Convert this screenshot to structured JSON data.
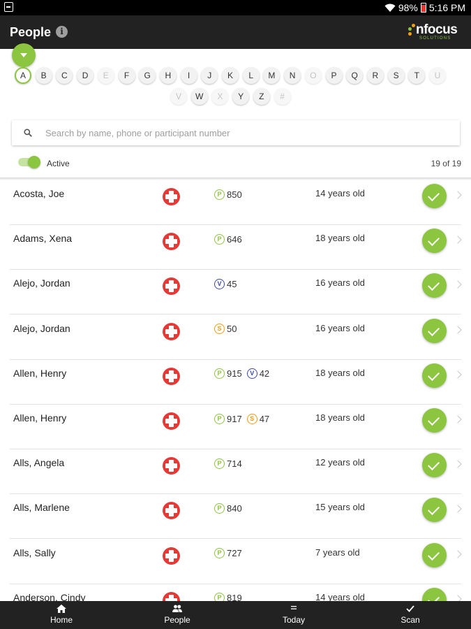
{
  "status_bar": {
    "battery": "98%",
    "time": "5:16 PM"
  },
  "app_bar": {
    "title": "People",
    "info_symbol": "i",
    "logo_text": "nfocus",
    "logo_sub": "SOLUTIONS"
  },
  "colors": {
    "accent": "#8cc540",
    "appbar": "#222222",
    "medical": "#e53935",
    "badge_P": "#8cc540",
    "badge_V": "#3949ab",
    "badge_S": "#f39c12"
  },
  "alphabet": {
    "selected": "A",
    "rows": [
      [
        {
          "label": "A",
          "enabled": true
        },
        {
          "label": "B",
          "enabled": true
        },
        {
          "label": "C",
          "enabled": true
        },
        {
          "label": "D",
          "enabled": true
        },
        {
          "label": "E",
          "enabled": false
        },
        {
          "label": "F",
          "enabled": true
        },
        {
          "label": "G",
          "enabled": true
        },
        {
          "label": "H",
          "enabled": true
        },
        {
          "label": "I",
          "enabled": true
        },
        {
          "label": "J",
          "enabled": true
        },
        {
          "label": "K",
          "enabled": true
        },
        {
          "label": "L",
          "enabled": true
        },
        {
          "label": "M",
          "enabled": true
        },
        {
          "label": "N",
          "enabled": true
        },
        {
          "label": "O",
          "enabled": false
        },
        {
          "label": "P",
          "enabled": true
        },
        {
          "label": "Q",
          "enabled": true
        },
        {
          "label": "R",
          "enabled": true
        },
        {
          "label": "S",
          "enabled": true
        },
        {
          "label": "T",
          "enabled": true
        },
        {
          "label": "U",
          "enabled": false
        }
      ],
      [
        {
          "label": "V",
          "enabled": false
        },
        {
          "label": "W",
          "enabled": true
        },
        {
          "label": "X",
          "enabled": false
        },
        {
          "label": "Y",
          "enabled": true
        },
        {
          "label": "Z",
          "enabled": true
        },
        {
          "label": "#",
          "enabled": false
        }
      ]
    ]
  },
  "search": {
    "placeholder": "Search by name, phone or participant number",
    "value": ""
  },
  "filter": {
    "active_label": "Active",
    "active": true,
    "count": "19 of 19"
  },
  "people": [
    {
      "name": "Acosta, Joe",
      "ids": [
        {
          "type": "P",
          "value": "850"
        }
      ],
      "age": "14 years old"
    },
    {
      "name": "Adams, Xena",
      "ids": [
        {
          "type": "P",
          "value": "646"
        }
      ],
      "age": "18 years old"
    },
    {
      "name": "Alejo, Jordan",
      "ids": [
        {
          "type": "V",
          "value": "45"
        }
      ],
      "age": "16 years old"
    },
    {
      "name": "Alejo, Jordan",
      "ids": [
        {
          "type": "S",
          "value": "50"
        }
      ],
      "age": "16 years old"
    },
    {
      "name": "Allen, Henry",
      "ids": [
        {
          "type": "P",
          "value": "915"
        },
        {
          "type": "V",
          "value": "42"
        }
      ],
      "age": "18 years old"
    },
    {
      "name": "Allen, Henry",
      "ids": [
        {
          "type": "P",
          "value": "917"
        },
        {
          "type": "S",
          "value": "47"
        }
      ],
      "age": "18 years old"
    },
    {
      "name": "Alls, Angela",
      "ids": [
        {
          "type": "P",
          "value": "714"
        }
      ],
      "age": "12 years old"
    },
    {
      "name": "Alls, Marlene",
      "ids": [
        {
          "type": "P",
          "value": "840"
        }
      ],
      "age": "15 years old"
    },
    {
      "name": "Alls, Sally",
      "ids": [
        {
          "type": "P",
          "value": "727"
        }
      ],
      "age": "7 years old"
    },
    {
      "name": "Anderson, Cindy",
      "ids": [
        {
          "type": "P",
          "value": "819"
        }
      ],
      "age": "14 years old"
    }
  ],
  "bottom_nav": [
    {
      "label": "Home",
      "icon": "home-icon"
    },
    {
      "label": "People",
      "icon": "people-icon"
    },
    {
      "label": "Today",
      "icon": "today-icon"
    },
    {
      "label": "Scan",
      "icon": "scan-icon"
    }
  ]
}
